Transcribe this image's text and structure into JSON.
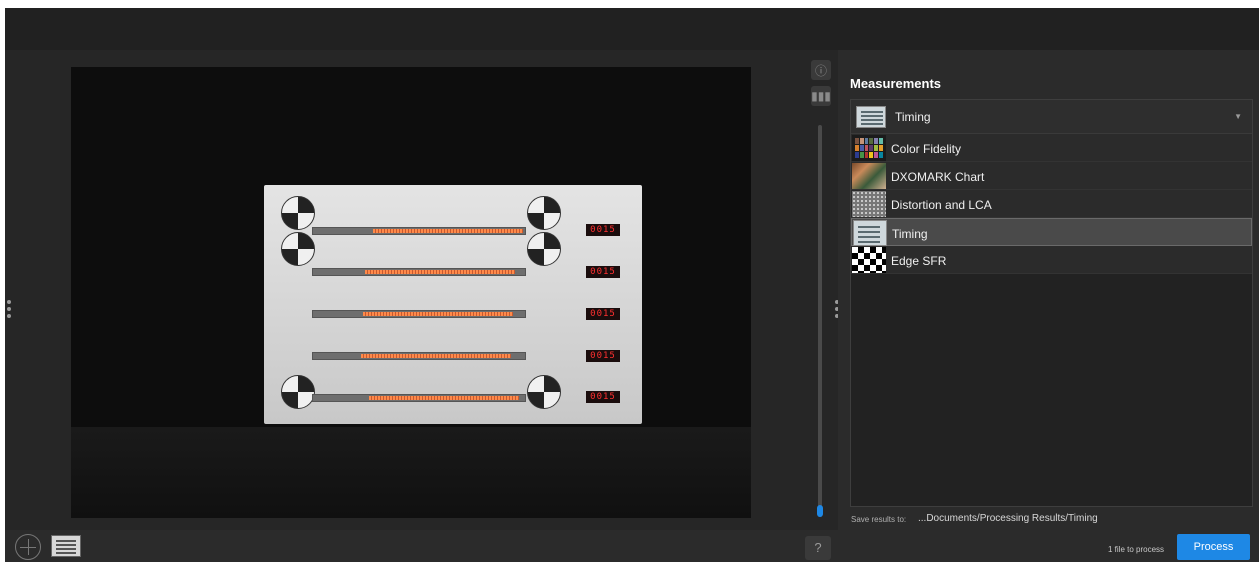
{
  "panel": {
    "title": "Measurements",
    "dropdown_selected": "Timing",
    "items": [
      {
        "label": "Color Fidelity",
        "icon": "color-checker-icon"
      },
      {
        "label": "DXOMARK Chart",
        "icon": "dxomark-chart-icon"
      },
      {
        "label": "Distortion and LCA",
        "icon": "distortion-grid-icon"
      },
      {
        "label": "Timing",
        "icon": "timing-chart-icon",
        "selected": true
      },
      {
        "label": "Edge SFR",
        "icon": "checkerboard-icon"
      }
    ],
    "save_label": "Save results to:",
    "save_path": "...Documents/Processing Results/Timing",
    "files_count": "1 file to process",
    "process_label": "Process"
  },
  "viewer": {
    "led_readouts": [
      "0015",
      "0015",
      "0015",
      "0015",
      "0015"
    ],
    "help_label": "?"
  },
  "colors": {
    "accent": "#1e88e5",
    "panel_bg": "#2b2b2b",
    "led": "#ff3030",
    "bar": "#ff8a4a"
  }
}
